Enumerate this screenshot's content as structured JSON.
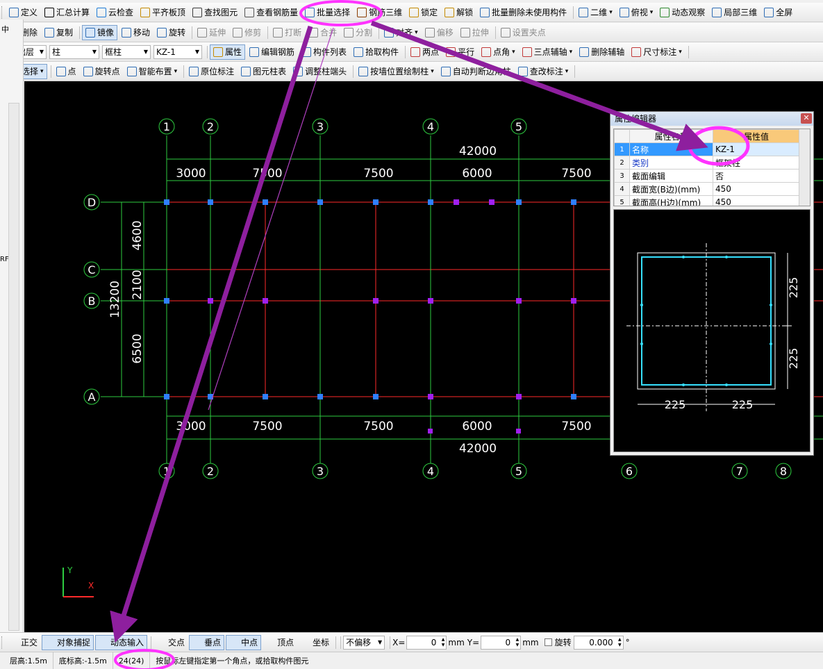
{
  "toolbar1": [
    {
      "label": "定义",
      "icon": "define-icon",
      "color": "#2f6db5"
    },
    {
      "label": "汇总计算",
      "icon": "sigma-icon",
      "color": "#000000"
    },
    {
      "label": "云检查",
      "icon": "cloud-check-icon",
      "color": "#1f7bd6"
    },
    {
      "label": "平齐板顶",
      "icon": "align-slab-icon",
      "color": "#c58a00"
    },
    {
      "label": "查找图元",
      "icon": "binoculars-icon",
      "color": "#3b3b3b"
    },
    {
      "label": "查看钢筋量",
      "icon": "view-rebar-icon",
      "color": "#555555"
    },
    {
      "label": "批量选择",
      "icon": "batch-select-icon",
      "color": "#2f6db5"
    },
    {
      "label": "钢筋三维",
      "icon": "rebar-3d-icon",
      "color": "#8a3c00"
    },
    {
      "label": "锁定",
      "icon": "lock-icon",
      "color": "#c58a00"
    },
    {
      "label": "解锁",
      "icon": "unlock-icon",
      "color": "#c58a00"
    },
    {
      "label": "批量删除未使用构件",
      "icon": "batch-delete-icon",
      "color": "#2f6db5"
    },
    {
      "label": "二维",
      "icon": "2d-icon",
      "color": "#2f6db5",
      "dropdown": true
    },
    {
      "label": "俯视",
      "icon": "top-view-icon",
      "color": "#2f6db5",
      "dropdown": true
    },
    {
      "label": "动态观察",
      "icon": "orbit-icon",
      "color": "#2f8a2f"
    },
    {
      "label": "局部三维",
      "icon": "local-3d-icon",
      "color": "#2f6db5"
    },
    {
      "label": "全屏",
      "icon": "fullscreen-icon",
      "color": "#2f6db5"
    }
  ],
  "toolbar2": [
    {
      "label": "删除",
      "icon": "delete-icon",
      "color": "#2f6db5"
    },
    {
      "label": "复制",
      "icon": "copy-icon",
      "color": "#2f6db5"
    },
    {
      "label": "镜像",
      "icon": "mirror-icon",
      "color": "#2f6db5",
      "pressed": true
    },
    {
      "label": "移动",
      "icon": "move-icon",
      "color": "#2f6db5"
    },
    {
      "label": "旋转",
      "icon": "rotate-icon",
      "color": "#2f6db5"
    },
    {
      "label": "延伸",
      "icon": "extend-icon",
      "color": "#888888",
      "disabled": true
    },
    {
      "label": "修剪",
      "icon": "trim-icon",
      "color": "#888888",
      "disabled": true
    },
    {
      "label": "打断",
      "icon": "break-icon",
      "color": "#888888",
      "disabled": true
    },
    {
      "label": "合并",
      "icon": "merge-icon",
      "color": "#888888",
      "disabled": true
    },
    {
      "label": "分割",
      "icon": "split-icon",
      "color": "#888888",
      "disabled": true
    },
    {
      "label": "对齐",
      "icon": "align-icon",
      "color": "#2f6db5",
      "dropdown": true
    },
    {
      "label": "偏移",
      "icon": "offset-icon",
      "color": "#888888",
      "disabled": true
    },
    {
      "label": "拉伸",
      "icon": "stretch-icon",
      "color": "#888888",
      "disabled": true
    },
    {
      "label": "设置夹点",
      "icon": "grip-point-icon",
      "color": "#888888",
      "disabled": true
    }
  ],
  "toolbar3": {
    "floor": "基础层",
    "category": "柱",
    "type": "框柱",
    "component": "KZ-1",
    "items": [
      {
        "label": "属性",
        "icon": "properties-icon",
        "color": "#c58a00",
        "pressed": true
      },
      {
        "label": "编辑钢筋",
        "icon": "edit-rebar-icon",
        "color": "#2f6db5"
      },
      {
        "label": "构件列表",
        "icon": "component-list-icon",
        "color": "#2f6db5"
      },
      {
        "label": "拾取构件",
        "icon": "pick-component-icon",
        "color": "#2f6db5"
      },
      {
        "label": "两点",
        "icon": "two-point-icon",
        "color": "#c23a3a"
      },
      {
        "label": "平行",
        "icon": "parallel-icon",
        "color": "#c23a3a"
      },
      {
        "label": "点角",
        "icon": "point-angle-icon",
        "color": "#c23a3a",
        "dropdown": true
      },
      {
        "label": "三点辅轴",
        "icon": "three-point-axis-icon",
        "color": "#c23a3a",
        "dropdown": true
      },
      {
        "label": "删除辅轴",
        "icon": "delete-axis-icon",
        "color": "#2f6db5"
      },
      {
        "label": "尺寸标注",
        "icon": "dimension-icon",
        "color": "#c23a3a",
        "dropdown": true
      }
    ]
  },
  "toolbar4": [
    {
      "label": "选择",
      "icon": "cursor-icon",
      "color": "#2f6db5",
      "pressed": true,
      "dropdown": true
    },
    {
      "label": "点",
      "icon": "point-icon",
      "color": "#2f6db5"
    },
    {
      "label": "旋转点",
      "icon": "rotate-point-icon",
      "color": "#2f6db5"
    },
    {
      "label": "智能布置",
      "icon": "smart-layout-icon",
      "color": "#2f6db5",
      "dropdown": true
    },
    {
      "label": "原位标注",
      "icon": "in-place-label-icon",
      "color": "#2f6db5"
    },
    {
      "label": "图元柱表",
      "icon": "column-table-icon",
      "color": "#2f6db5"
    },
    {
      "label": "调整柱端头",
      "icon": "adjust-column-end-icon",
      "color": "#2f6db5"
    },
    {
      "label": "按墙位置绘制柱",
      "icon": "wall-column-icon",
      "color": "#2f6db5",
      "dropdown": true
    },
    {
      "label": "自动判断边角柱",
      "icon": "auto-corner-column-icon",
      "color": "#2f6db5"
    },
    {
      "label": "查改标注",
      "icon": "check-label-icon",
      "color": "#2f6db5",
      "dropdown": true
    }
  ],
  "grid": {
    "x_axes": [
      "1",
      "2",
      "3",
      "4",
      "5",
      "6",
      "7",
      "8"
    ],
    "y_axes": [
      "D",
      "C",
      "B",
      "A"
    ],
    "x_total": "42000",
    "x_spacings": [
      "3000",
      "7500",
      "7500",
      "6000",
      "7500"
    ],
    "y_total": "13200",
    "y_spacings": [
      "4600",
      "2100",
      "6500"
    ]
  },
  "property_editor": {
    "title": "属性编辑器",
    "col_name": "属性名称",
    "col_value": "属性值",
    "rows": [
      {
        "num": "1",
        "name": "名称",
        "value": "KZ-1"
      },
      {
        "num": "2",
        "name": "类别",
        "value": "框架柱"
      },
      {
        "num": "3",
        "name": "截面编辑",
        "value": "否"
      },
      {
        "num": "4",
        "name": "截面宽(B边)(mm)",
        "value": "450"
      },
      {
        "num": "5",
        "name": "截面高(H边)(mm)",
        "value": "450"
      }
    ],
    "preview_dims": {
      "right_top": "225",
      "right_bottom": "225",
      "bottom_left": "225",
      "bottom_right": "225"
    }
  },
  "statusbar": {
    "items": [
      {
        "label": "正交",
        "icon": "ortho-icon"
      },
      {
        "label": "对象捕捉",
        "icon": "object-snap-icon",
        "pressed": true
      },
      {
        "label": "动态输入",
        "icon": "dynamic-input-icon",
        "pressed": true
      },
      {
        "label": "交点",
        "icon": "intersection-icon"
      },
      {
        "label": "垂点",
        "icon": "perpendicular-icon",
        "pressed": true
      },
      {
        "label": "中点",
        "icon": "midpoint-icon",
        "pressed": true
      },
      {
        "label": "顶点",
        "icon": "vertex-icon"
      },
      {
        "label": "坐标",
        "icon": "coordinate-icon"
      }
    ],
    "offset_mode": "不偏移",
    "x_label": "X=",
    "x_value": "0",
    "y_label": "Y=",
    "y_value": "0",
    "unit": "mm",
    "rotate_label": "旋转",
    "rotate_value": "0.000",
    "degree": "°"
  },
  "infobar": {
    "floor_height": "层高:1.5m",
    "base_elevation": "底标高:-1.5m",
    "count": "24(24)",
    "hint": "按鼠标左键指定第一个角点，或拾取构件图元"
  },
  "left_panel": {
    "label1": "中",
    "label2": "RF"
  },
  "colors": {
    "axis_green": "#2ecc40",
    "grid_red": "#ff2a2a",
    "column_purple": "#a020f0",
    "column_blue": "#2f7fff",
    "annotation_magenta": "#ff33ff",
    "arrow_purple": "#8e1f9e",
    "preview_cyan": "#36e0ff"
  }
}
